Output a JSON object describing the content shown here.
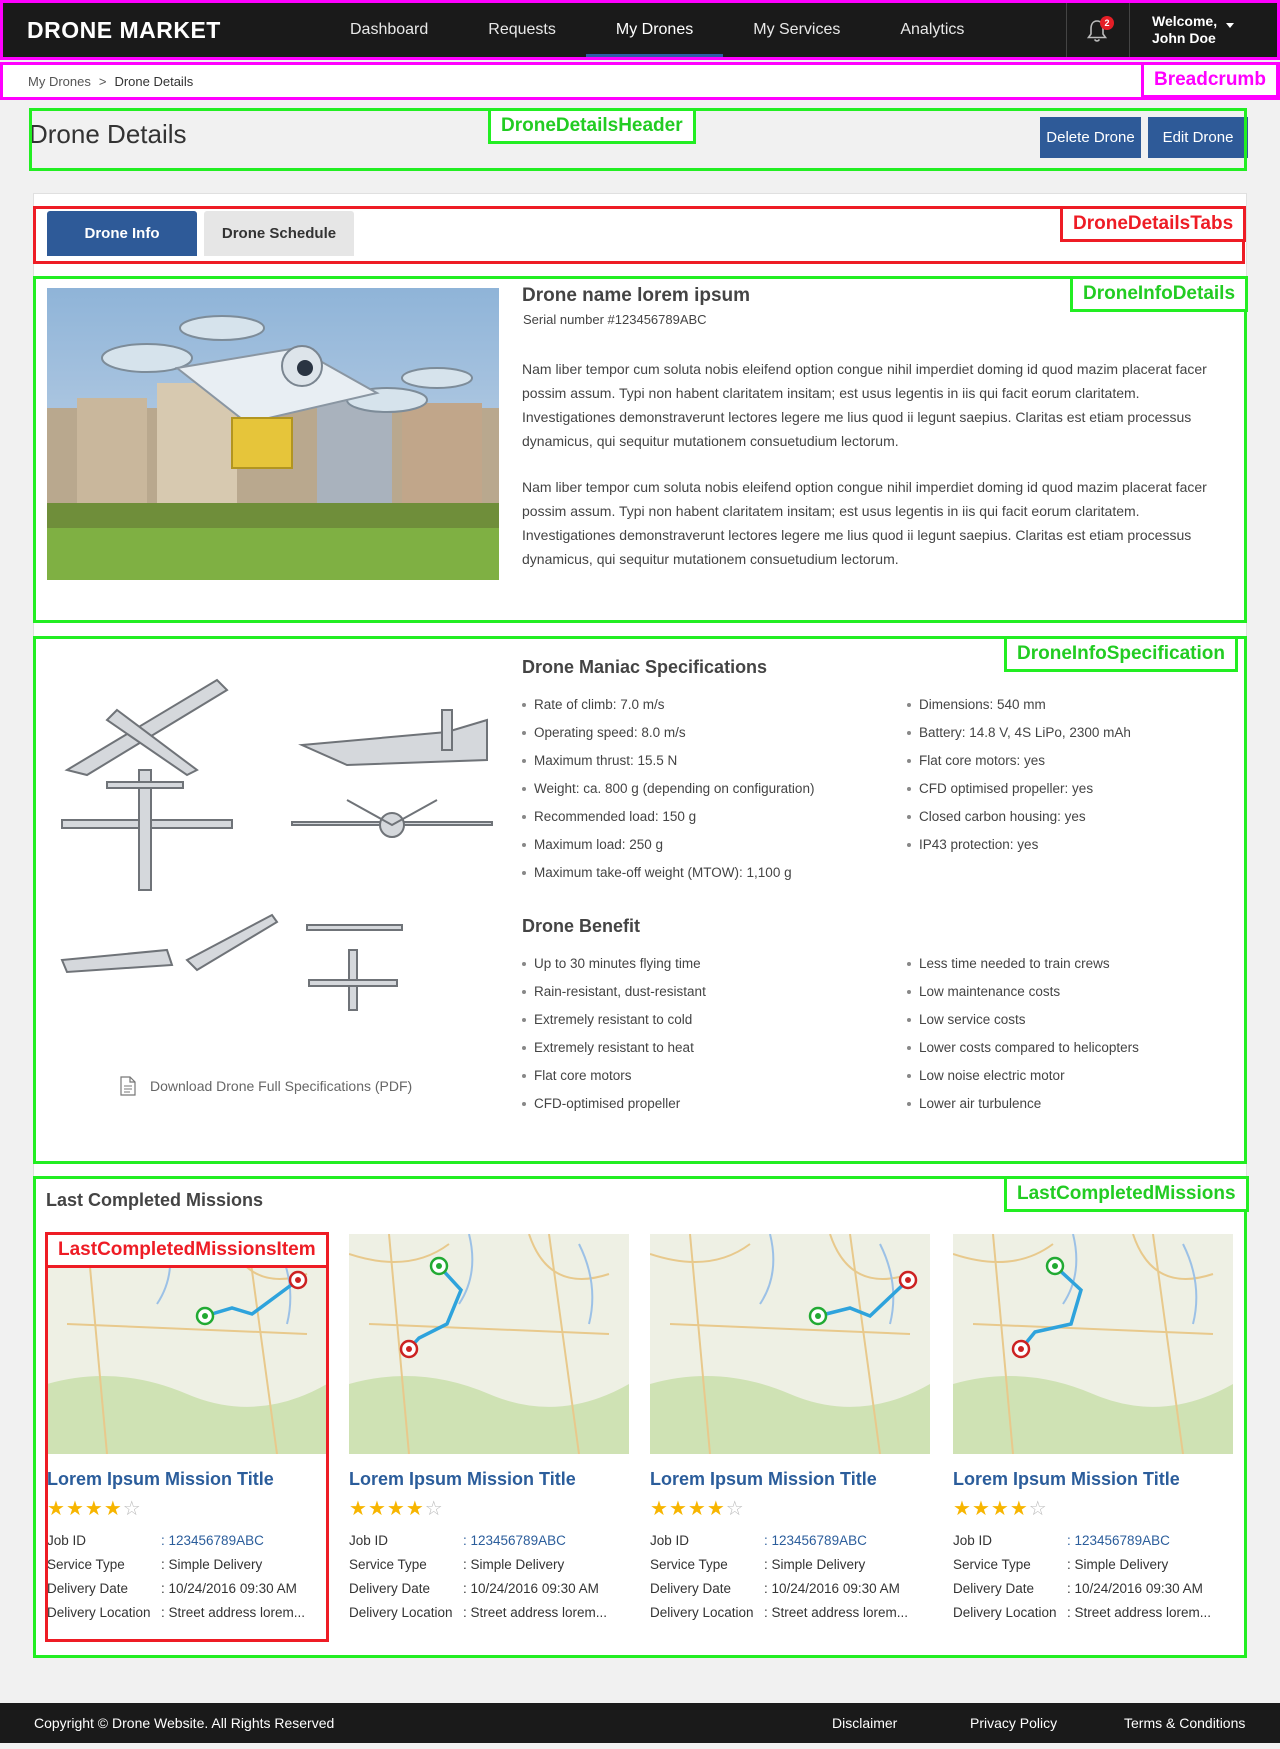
{
  "topnav": {
    "brand": "DRONE MARKET",
    "links": [
      "Dashboard",
      "Requests",
      "My Drones",
      "My Services",
      "Analytics"
    ],
    "notification_count": "2",
    "welcome_line1": "Welcome,",
    "welcome_line2": "John Doe"
  },
  "breadcrumb": {
    "items": [
      "My Drones",
      "Drone Details"
    ],
    "separator": ">"
  },
  "header": {
    "title": "Drone Details",
    "delete_label": "Delete Drone",
    "edit_label": "Edit Drone"
  },
  "tabs": [
    "Drone Info",
    "Drone Schedule"
  ],
  "drone": {
    "name": "Drone name lorem ipsum",
    "serial": "Serial number #123456789ABC",
    "paragraph1": "Nam liber tempor cum soluta nobis eleifend option congue nihil imperdiet doming id quod mazim placerat facer possim assum. Typi non habent claritatem insitam; est usus legentis in iis qui facit eorum claritatem. Investigationes demonstraverunt lectores legere me lius quod ii legunt saepius. Claritas est etiam processus dynamicus, qui sequitur mutationem consuetudium lectorum.",
    "paragraph2": "Nam liber tempor cum soluta nobis eleifend option congue nihil imperdiet doming id quod mazim placerat facer possim assum. Typi non habent claritatem insitam; est usus legentis in iis qui facit eorum claritatem. Investigationes demonstraverunt lectores legere me lius quod ii legunt saepius. Claritas est etiam processus dynamicus, qui sequitur mutationem consuetudium lectorum."
  },
  "specs": {
    "title": "Drone Maniac Specifications",
    "left": [
      "Rate of climb: 7.0 m/s",
      "Operating speed: 8.0 m/s",
      "Maximum thrust: 15.5 N",
      "Weight: ca. 800 g (depending on configuration)",
      "Recommended load: 150 g",
      "Maximum load: 250 g",
      "Maximum take-off weight (MTOW): 1,100 g"
    ],
    "right": [
      "Dimensions: 540 mm",
      "Battery: 14.8 V, 4S LiPo, 2300 mAh",
      "Flat core motors: yes",
      "CFD optimised propeller: yes",
      "Closed carbon housing: yes",
      "IP43 protection: yes"
    ],
    "download_label": "Download Drone Full Specifications (PDF)"
  },
  "benefits": {
    "title": "Drone Benefit",
    "left": [
      "Up to 30 minutes flying time",
      "Rain-resistant, dust-resistant",
      "Extremely resistant to cold",
      "Extremely resistant to heat",
      "Flat core motors",
      "CFD-optimised propeller"
    ],
    "right": [
      "Less time needed to train crews",
      "Low maintenance costs",
      "Low service costs",
      "Lower costs compared to helicopters",
      "Low noise electric motor",
      "Lower air turbulence"
    ]
  },
  "missions": {
    "title": "Last Completed Missions",
    "labels": {
      "job_id": "Job ID",
      "service_type": "Service Type",
      "delivery_date": "Delivery Date",
      "delivery_location": "Delivery Location"
    },
    "items": [
      {
        "title": "Lorem Ipsum Mission Title",
        "rating": 4,
        "job_id": ": 123456789ABC",
        "service_type": ": Simple Delivery",
        "delivery_date": ": 10/24/2016  09:30 AM",
        "delivery_location": ": Street address lorem..."
      },
      {
        "title": "Lorem Ipsum Mission Title",
        "rating": 4,
        "job_id": ": 123456789ABC",
        "service_type": ": Simple Delivery",
        "delivery_date": ": 10/24/2016  09:30 AM",
        "delivery_location": ": Street address lorem..."
      },
      {
        "title": "Lorem Ipsum Mission Title",
        "rating": 4,
        "job_id": ": 123456789ABC",
        "service_type": ": Simple Delivery",
        "delivery_date": ": 10/24/2016  09:30 AM",
        "delivery_location": ": Street address lorem..."
      },
      {
        "title": "Lorem Ipsum Mission Title",
        "rating": 4,
        "job_id": ": 123456789ABC",
        "service_type": ": Simple Delivery",
        "delivery_date": ": 10/24/2016  09:30 AM",
        "delivery_location": ": Street address lorem..."
      }
    ]
  },
  "footer": {
    "copyright": "Copyright © Drone Website. All Rights Reserved",
    "links": [
      "Disclaimer",
      "Privacy Policy",
      "Terms & Conditions"
    ]
  },
  "annotations": {
    "breadcrumb": "Breadcrumb",
    "header": "DroneDetailsHeader",
    "tabs": "DroneDetailsTabs",
    "info": "DroneInfoDetails",
    "spec": "DroneInfoSpecification",
    "missions": "LastCompletedMissions",
    "mission_item": "LastCompletedMissionsItem"
  },
  "colors": {
    "accent": "#2e5a98",
    "annotation_magenta": "#ff00ff",
    "annotation_green": "#22ee22",
    "annotation_red": "#ee1c25",
    "star": "#f7b500"
  }
}
